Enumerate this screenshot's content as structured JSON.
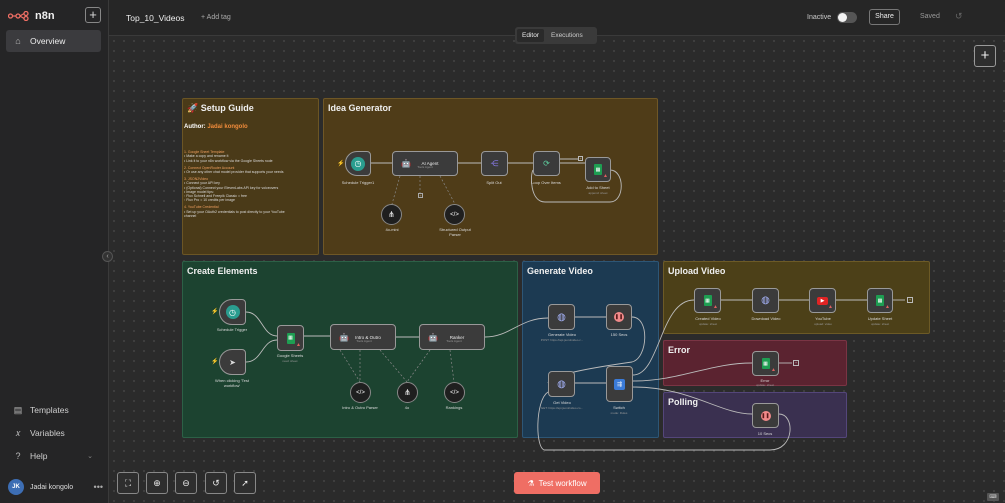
{
  "app": {
    "logo_text": "n8n"
  },
  "sidebar": {
    "items": [
      {
        "label": "Overview",
        "icon": "home-icon"
      },
      {
        "label": "Templates",
        "icon": "templates-icon"
      },
      {
        "label": "Variables",
        "icon": "variables-icon"
      },
      {
        "label": "Help",
        "icon": "help-icon"
      }
    ],
    "user": {
      "initials": "JK",
      "name": "Jadai kongolo"
    }
  },
  "header": {
    "workflow_name": "Top_10_Videos",
    "add_tag": "+ Add tag",
    "status": "Inactive",
    "share": "Share",
    "saved": "Saved"
  },
  "tabs": {
    "editor": "Editor",
    "executions": "Executions"
  },
  "groups": {
    "setup": "🚀 Setup Guide",
    "idea": "Idea Generator",
    "create": "Create Elements",
    "generate": "Generate Video",
    "upload": "Upload Video",
    "error": "Error",
    "polling": "Polling"
  },
  "guide": {
    "author_prefix": "Author:",
    "author_name": "Jadai kongolo",
    "lines": [
      "1. Google Sheet Template",
      "  • Make a copy and rename it",
      "  • Link it to your n8n workflow via the Google Sheets node",
      "2. Connect OpenRouter Account",
      "  • Or use any other chat model provider that supports your needs",
      "3. JSON2Video",
      "  • Connect your API key",
      "  • (Optional) Connect your ElevenLabs API key for voiceovers",
      "  • Image model tips:",
      "    ◦ Flux Schnell and Freepik Classic = free",
      "    ◦ Flux Pro = 10 credits per image",
      "4. YouTube Credential",
      "  • Set up your OAuth2 credentials to post directly to your YouTube",
      "    channel"
    ]
  },
  "nodes": {
    "schedule1": {
      "label": "Schedule Trigger1"
    },
    "ai_agent": {
      "label": "AI Agent",
      "sub": "Tools Agent"
    },
    "split_out": {
      "label": "Split Out"
    },
    "loop": {
      "label": "Loop Over Items"
    },
    "add_sheet": {
      "label": "Add to Sheet",
      "sub": "append: sheet"
    },
    "ao_mini": {
      "label": "4o-mini"
    },
    "struct_parser": {
      "label": "Structured Output Parser"
    },
    "schedule": {
      "label": "Schedule Trigger"
    },
    "manual": {
      "label": "When clicking 'Test workflow'"
    },
    "gsheets": {
      "label": "Google Sheets",
      "sub": "read: sheet"
    },
    "intro_outro": {
      "label": "Intro & Outro",
      "sub": "Tools Agent"
    },
    "ranker": {
      "label": "Ranker",
      "sub": "Tools Agent"
    },
    "intro_parser": {
      "label": "Intro & Outro Parser"
    },
    "model_4o": {
      "label": "4o"
    },
    "rankings": {
      "label": "Rankings"
    },
    "gen_video": {
      "label": "Generate Video",
      "sub": "POST: https://api.json2video.c..."
    },
    "wait150": {
      "label": "150 Secs"
    },
    "get_video": {
      "label": "Get Video",
      "sub": "GET: https://api.json2video.co..."
    },
    "switch": {
      "label": "Switch",
      "sub": "mode: Rules"
    },
    "created_video": {
      "label": "Created Video",
      "sub": "update: sheet"
    },
    "download": {
      "label": "Download Video"
    },
    "youtube": {
      "label": "YouTube",
      "sub": "upload: video"
    },
    "update_sheet": {
      "label": "Update Sheet",
      "sub": "update: sheet"
    },
    "error_node": {
      "label": "Error",
      "sub": "update: sheet"
    },
    "wait10": {
      "label": "10 Secs"
    }
  },
  "test_button": "Test workflow",
  "colors": {
    "setup": "#4a3a18",
    "idea": "#4f3c18",
    "create": "#1c4330",
    "generate": "#1c3a52",
    "upload": "#4c4018",
    "error": "#5b2330",
    "polling": "#3a3050",
    "accent": "#ef6e64"
  }
}
